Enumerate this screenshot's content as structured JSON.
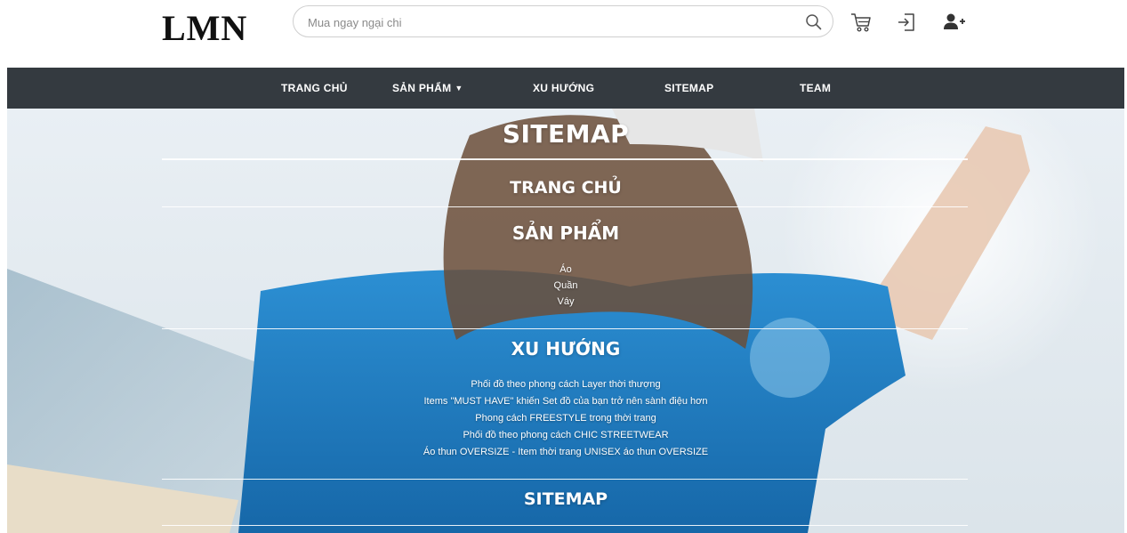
{
  "header": {
    "logo": "LMN",
    "search_placeholder": "Mua ngay ngại chi",
    "icons": [
      "search-icon",
      "cart-icon",
      "login-icon",
      "user-add-icon"
    ]
  },
  "nav": {
    "items": [
      {
        "label": "TRANG CHỦ"
      },
      {
        "label": "SẢN PHẨM",
        "dropdown": true
      },
      {
        "label": "XU HƯỚNG"
      },
      {
        "label": "SITEMAP"
      },
      {
        "label": "TEAM"
      }
    ]
  },
  "sitemap": {
    "title": "SITEMAP",
    "home": "TRANG CHỦ",
    "products": {
      "title": "SẢN PHẨM",
      "items": [
        "Áo",
        "Quần",
        "Váy"
      ]
    },
    "trends": {
      "title": "XU HƯỚNG",
      "items": [
        "Phối đồ theo phong cách Layer thời thượng",
        "Items \"MUST HAVE\" khiến Set đồ của bạn trở nên sành điệu hơn",
        "Phong cách FREESTYLE trong thời trang",
        "Phối đồ theo phong cách CHIC STREETWEAR",
        "Áo thun OVERSIZE - Item thời trang UNISEX áo thun OVERSIZE"
      ]
    },
    "sitemap_section": "SITEMAP"
  },
  "colors": {
    "nav_bg": "#343a40",
    "shirt_blue": "#1f7fc7",
    "sky": "#dfe9f1"
  }
}
